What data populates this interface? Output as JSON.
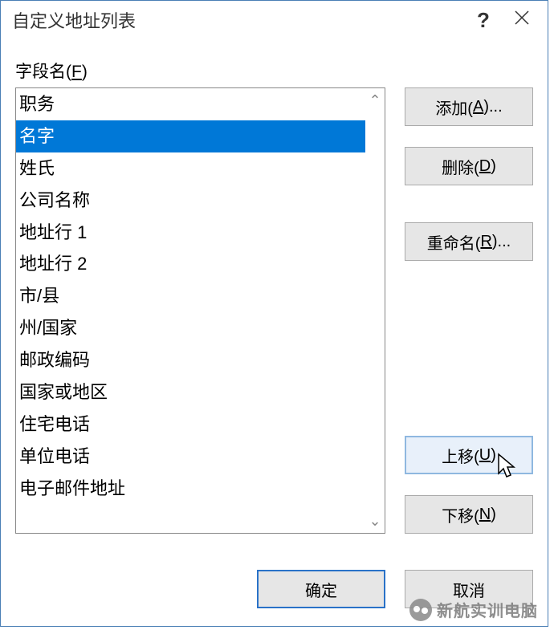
{
  "titlebar": {
    "title": "自定义地址列表",
    "help": "?",
    "close": "×"
  },
  "field_label": {
    "text": "字段名(",
    "accel": "F",
    "suffix": ")"
  },
  "list_items": [
    "职务",
    "名字",
    "姓氏",
    "公司名称",
    "地址行 1",
    "地址行 2",
    "市/县",
    "州/国家",
    "邮政编码",
    "国家或地区",
    "住宅电话",
    "单位电话",
    "电子邮件地址"
  ],
  "selected_index": 1,
  "buttons": {
    "add": {
      "pre": "添加(",
      "accel": "A",
      "suf": ")..."
    },
    "delete": {
      "pre": "删除(",
      "accel": "D",
      "suf": ")"
    },
    "rename": {
      "pre": "重命名(",
      "accel": "R",
      "suf": ")..."
    },
    "move_up": {
      "pre": "上移(",
      "accel": "U",
      "suf": ")"
    },
    "move_down": {
      "pre": "下移(",
      "accel": "N",
      "suf": ")"
    },
    "ok": "确定",
    "cancel": "取消"
  },
  "watermark": "新航实训电脑"
}
